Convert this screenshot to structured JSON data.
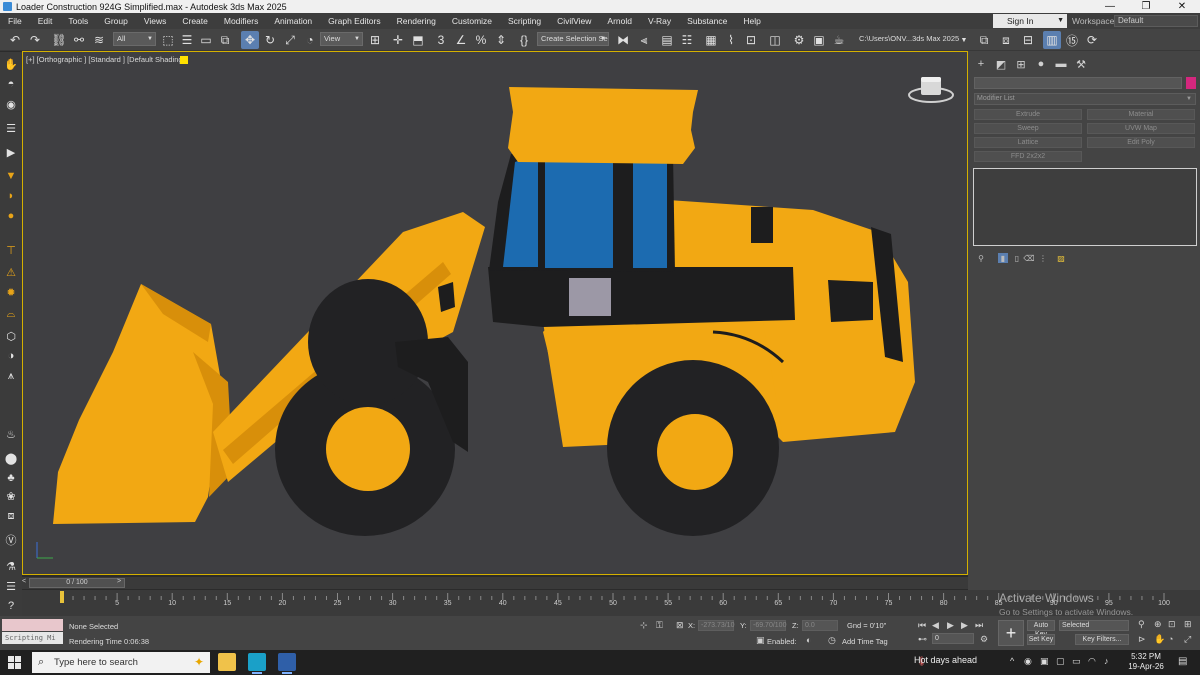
{
  "window": {
    "title": "Loader Construction 924G Simplified.max - Autodesk 3ds Max 2025",
    "controls": [
      "—",
      "❐",
      "✕"
    ]
  },
  "menu": {
    "items": [
      "File",
      "Edit",
      "Tools",
      "Group",
      "Views",
      "Create",
      "Modifiers",
      "Animation",
      "Graph Editors",
      "Rendering",
      "Customize",
      "Scripting",
      "CivilView",
      "Arnold",
      "V-Ray",
      "Substance",
      "Help"
    ],
    "sign_in": "Sign In",
    "workspaces_label": "Workspaces:",
    "workspaces_value": "Default"
  },
  "toolbar": {
    "selection_filter": "All",
    "reference_coord": "View",
    "named_selection": "Create Selection Se",
    "project_path": "C:\\Users\\ONV...3ds Max 2025",
    "snap_value": "3"
  },
  "viewport": {
    "label": "[+] [Orthographic ] [Standard ] [Default Shading ]",
    "colors": {
      "background": "#3f3f42",
      "body": "#f2a813",
      "body_shade": "#d88f0a",
      "dark": "#1d1d1e",
      "tire": "#222224",
      "glass": "#1c6bb0",
      "window": "#9c98a6"
    }
  },
  "command_panel": {
    "modifier_list": "Modifier List",
    "buttons": [
      "Extrude",
      "Material",
      "Sweep",
      "UVW Map",
      "Lattice",
      "Edit Poly",
      "FFD 2x2x2"
    ],
    "accent_color": "#d4277e"
  },
  "timeline": {
    "frame_range": "0 / 100",
    "ticks": [
      5,
      10,
      15,
      20,
      25,
      30,
      35,
      40,
      45,
      50,
      55,
      60,
      65,
      70,
      75,
      80,
      85,
      90,
      95,
      100
    ]
  },
  "status": {
    "script_placeholder": "Scripting Mi",
    "selection": "None Selected",
    "render_time": "Rendering Time  0:06:38",
    "x_label": "X:",
    "x_value": "-273.73/10",
    "y_label": "Y:",
    "y_value": "-69.70/100",
    "z_label": "Z:",
    "z_value": "0.0",
    "grid": "Gnd = 0'10\"",
    "enabled_label": "Enabled:",
    "add_time_tag": "Add Time Tag",
    "frame_value": "0",
    "auto_key": "Auto Key",
    "selected_option": "Selected",
    "set_key": "Set Key",
    "key_filters": "Key Filters..."
  },
  "watermark": {
    "line1": "Activate Windows",
    "line2": "Go to Settings to activate Windows."
  },
  "taskbar": {
    "search_placeholder": "Type here to search",
    "weather": "Hot days ahead",
    "time": "5:32 PM",
    "date": "19-Apr-26"
  }
}
